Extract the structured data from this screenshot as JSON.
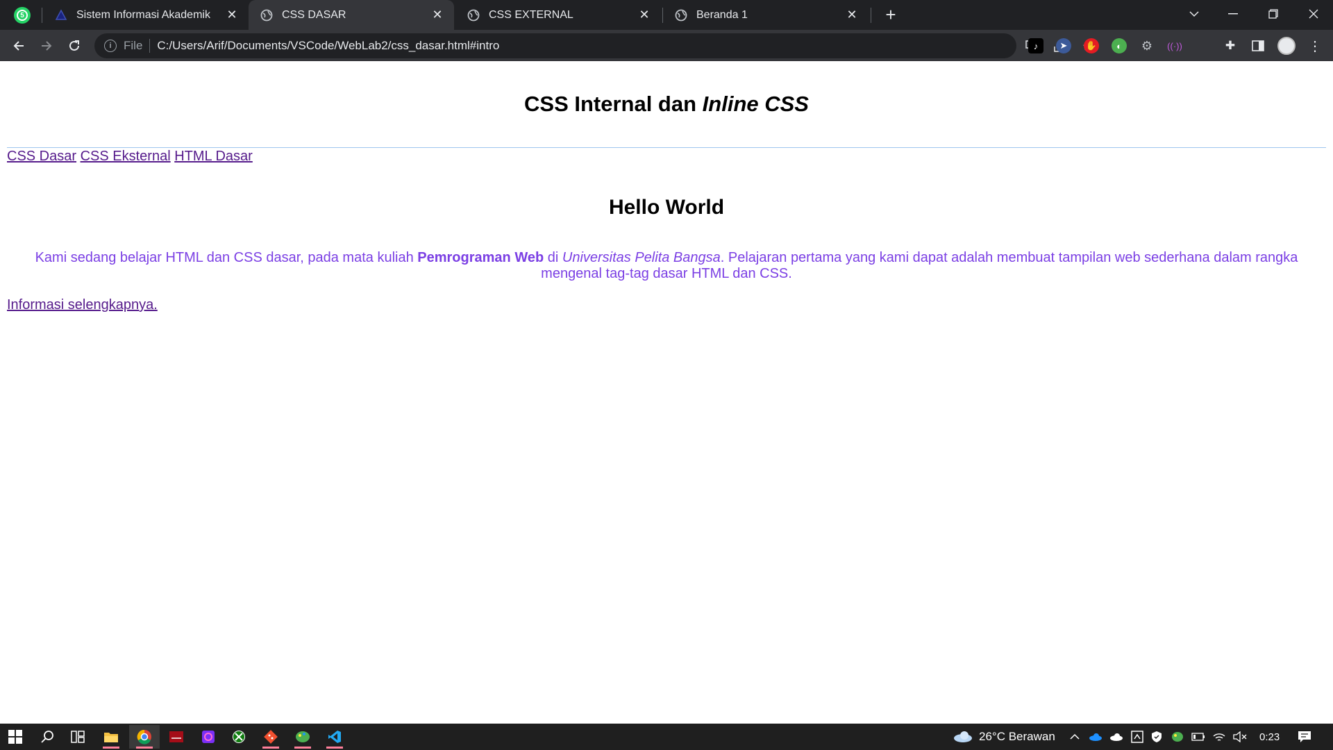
{
  "browser": {
    "pinned_tab_badge": "5",
    "tabs": [
      {
        "title": "Sistem Informasi Akademik",
        "icon": "university-favicon",
        "active": false
      },
      {
        "title": "CSS DASAR",
        "icon": "globe-icon",
        "active": true
      },
      {
        "title": "CSS EXTERNAL",
        "icon": "globe-icon",
        "active": false
      },
      {
        "title": "Beranda 1",
        "icon": "globe-icon",
        "active": false
      }
    ],
    "address": {
      "scheme": "File",
      "url": "C:/Users/Arif/Documents/VSCode/WebLab2/css_dasar.html#intro"
    },
    "extensions": [
      "translate-icon",
      "share-icon",
      "star-icon",
      "tiktok-ext-icon",
      "cursor-ext-icon",
      "adblock-ext-icon",
      "paint-ext-icon",
      "gear-ext-icon",
      "broadcast-ext-icon",
      "puzzle-icon",
      "sidepanel-icon"
    ]
  },
  "page": {
    "heading_main": "CSS Internal dan ",
    "heading_italic": "Inline CSS",
    "nav_links": [
      "CSS Dasar",
      "CSS Eksternal",
      "HTML Dasar"
    ],
    "hello": "Hello World",
    "intro": {
      "part1": "Kami sedang belajar HTML dan CSS dasar, pada mata kuliah ",
      "bold": "Pemrograman Web",
      "part2": " di ",
      "italic": "Universitas Pelita Bangsa",
      "part3": ". Pelajaran pertama yang kami dapat adalah membuat tampilan web sederhana dalam rangka mengenal tag-tag dasar HTML dan CSS."
    },
    "more_link": "Informasi selengkapnya.",
    "colors": {
      "intro_text": "#7b3fe4",
      "link": "#551a8b",
      "hr": "#9ec5ee"
    }
  },
  "taskbar": {
    "weather": "26°C  Berawan",
    "time": "0:23",
    "apps": [
      "start-icon",
      "search-icon",
      "task-view-icon",
      "file-explorer-icon",
      "chrome-icon",
      "red-app-icon",
      "purple-app-icon",
      "xbox-icon",
      "git-icon",
      "paint-app-icon",
      "vscode-icon"
    ]
  }
}
